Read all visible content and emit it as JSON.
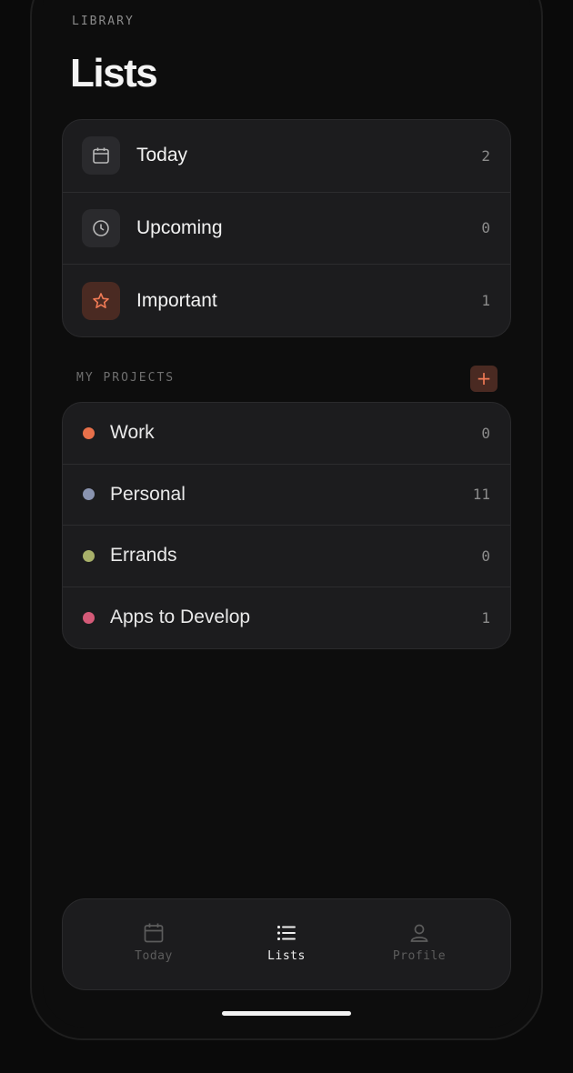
{
  "header": {
    "eyebrow": "LIBRARY",
    "title": "Lists"
  },
  "smart_lists": [
    {
      "label": "Today",
      "count": "2",
      "icon": "calendar-icon"
    },
    {
      "label": "Upcoming",
      "count": "0",
      "icon": "clock-icon"
    },
    {
      "label": "Important",
      "count": "1",
      "icon": "star-icon"
    }
  ],
  "projects": {
    "header": "MY PROJECTS",
    "add_label": "+",
    "items": [
      {
        "label": "Work",
        "count": "0",
        "color": "#e8704a"
      },
      {
        "label": "Personal",
        "count": "11",
        "color": "#8a94b0"
      },
      {
        "label": "Errands",
        "count": "0",
        "color": "#a8b06a"
      },
      {
        "label": "Apps to Develop",
        "count": "1",
        "color": "#d45a78"
      }
    ]
  },
  "tabbar": {
    "tabs": [
      {
        "label": "Today",
        "icon": "calendar-icon",
        "active": false
      },
      {
        "label": "Lists",
        "icon": "list-icon",
        "active": true
      },
      {
        "label": "Profile",
        "icon": "person-icon",
        "active": false
      }
    ]
  },
  "colors": {
    "accent": "#f07a55",
    "accent_bg": "#4a2a22",
    "card_bg": "#1c1c1e",
    "background": "#0d0d0d"
  }
}
